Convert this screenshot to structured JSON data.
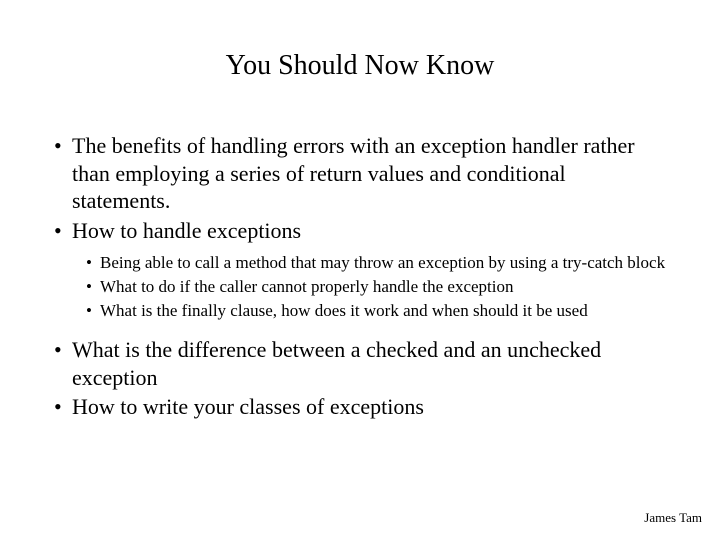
{
  "title": "You Should Now Know",
  "bullets": [
    {
      "text": "The benefits of handling errors with an exception handler rather than employing a series of return values and conditional statements."
    },
    {
      "text": "How to handle exceptions",
      "sub": [
        {
          "text": "Being able to call a method that may throw an exception by using a try-catch block"
        },
        {
          "text": "What to do if the caller cannot properly handle the exception"
        },
        {
          "text": "What is the finally clause, how does it work and when should it be used"
        }
      ]
    },
    {
      "text": "What is the difference between a checked and an unchecked exception"
    },
    {
      "text": "How to write your classes of exceptions"
    }
  ],
  "footer": "James Tam",
  "bullet_mark": "•"
}
